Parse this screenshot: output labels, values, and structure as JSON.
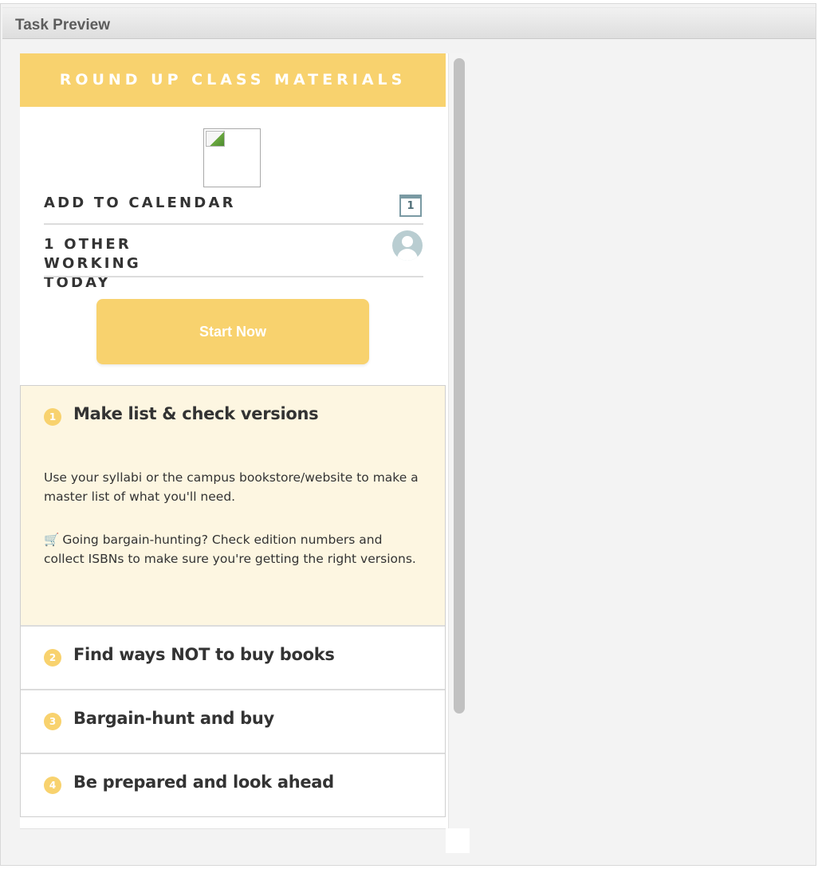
{
  "window": {
    "title": "Task Preview"
  },
  "task": {
    "title": "ROUND UP CLASS MATERIALS",
    "add_to_calendar": "ADD TO CALENDAR",
    "calendar_day": "1",
    "others_working": [
      "1 OTHER",
      "WORKING",
      "TODAY"
    ],
    "start_button": "Start Now"
  },
  "steps": [
    {
      "number": "1",
      "title": "Make list & check versions",
      "expanded": true,
      "paragraphs": [
        "Use your syllabi or the campus bookstore/website to make a master list of what you'll need.",
        "Going bargain-hunting? Check edition numbers and collect ISBNs to make sure you're getting the right versions."
      ],
      "icon": "shopping-cart-icon",
      "icon_glyph": "🛒"
    },
    {
      "number": "2",
      "title": "Find ways NOT to buy books",
      "expanded": false
    },
    {
      "number": "3",
      "title": "Bargain-hunt and buy",
      "expanded": false
    },
    {
      "number": "4",
      "title": "Be prepared and look ahead",
      "expanded": false
    }
  ],
  "colors": {
    "accent": "#f8d26e",
    "expanded_bg": "#fdf6e1",
    "text": "#333333",
    "icon": "#7a9aa3"
  }
}
